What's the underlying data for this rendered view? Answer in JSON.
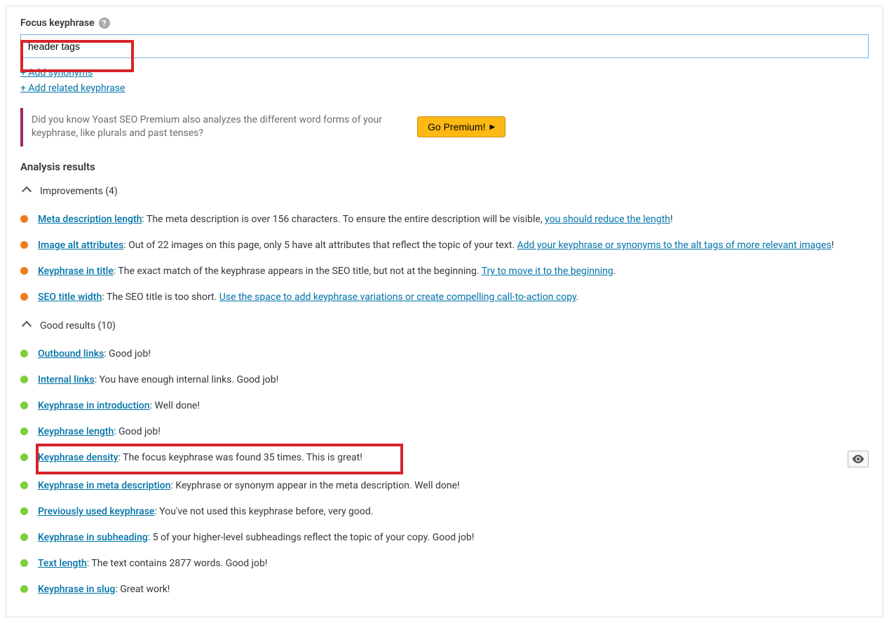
{
  "focus": {
    "label": "Focus keyphrase",
    "value": "header tags",
    "add_synonyms": "+ Add synonyms",
    "add_related": "+ Add related keyphrase"
  },
  "upsell": {
    "text": "Did you know Yoast SEO Premium also analyzes the different word forms of your keyphrase, like plurals and past tenses?",
    "button": "Go Premium!"
  },
  "analysis_heading": "Analysis results",
  "improvements": {
    "heading": "Improvements (4)",
    "items": [
      {
        "topic": "Meta description length",
        "text": ": The meta description is over 156 characters. To ensure the entire description will be visible, ",
        "action": "you should reduce the length",
        "suffix": "!"
      },
      {
        "topic": "Image alt attributes",
        "text": ": Out of 22 images on this page, only 5 have alt attributes that reflect the topic of your text. ",
        "action": "Add your keyphrase or synonyms to the alt tags of more relevant images",
        "suffix": "!"
      },
      {
        "topic": "Keyphrase in title",
        "text": ": The exact match of the keyphrase appears in the SEO title, but not at the beginning. ",
        "action": "Try to move it to the beginning",
        "suffix": "."
      },
      {
        "topic": "SEO title width",
        "text": ": The SEO title is too short. ",
        "action": "Use the space to add keyphrase variations or create compelling call-to-action copy",
        "suffix": "."
      }
    ]
  },
  "good": {
    "heading": "Good results (10)",
    "items": [
      {
        "topic": "Outbound links",
        "text": ": Good job!"
      },
      {
        "topic": "Internal links",
        "text": ": You have enough internal links. Good job!"
      },
      {
        "topic": "Keyphrase in introduction",
        "text": ": Well done!"
      },
      {
        "topic": "Keyphrase length",
        "text": ": Good job!"
      },
      {
        "topic": "Keyphrase density",
        "text": ": The focus keyphrase was found 35 times. This is great!",
        "eye": true,
        "highlight": true
      },
      {
        "topic": "Keyphrase in meta description",
        "text": ": Keyphrase or synonym appear in the meta description. Well done!"
      },
      {
        "topic": "Previously used keyphrase",
        "text": ": You've not used this keyphrase before, very good."
      },
      {
        "topic": "Keyphrase in subheading",
        "text": ": 5 of your higher-level subheadings reflect the topic of your copy. Good job!"
      },
      {
        "topic": "Text length",
        "text": ": The text contains 2877 words. Good job!"
      },
      {
        "topic": "Keyphrase in slug",
        "text": ": Great work!"
      }
    ]
  }
}
